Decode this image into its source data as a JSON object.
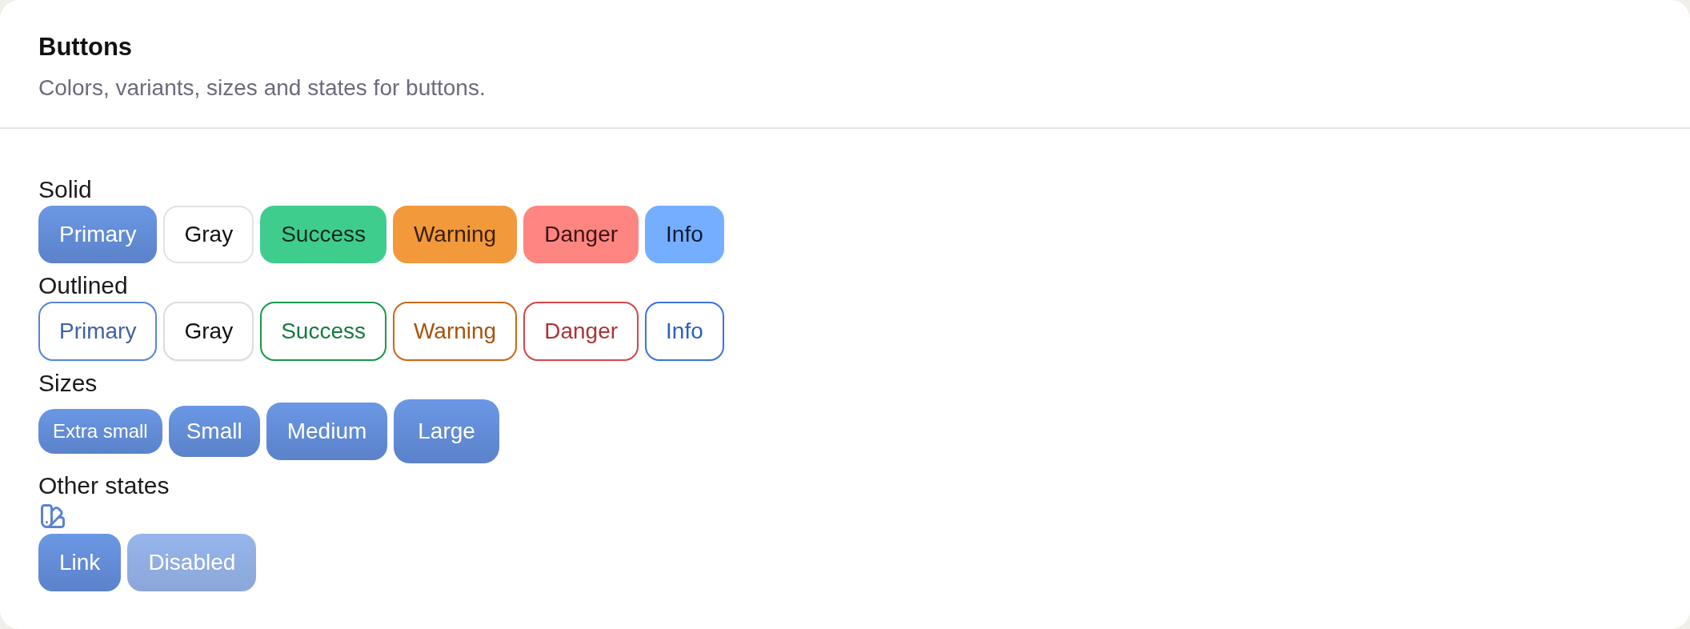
{
  "header": {
    "title": "Buttons",
    "subtitle": "Colors, variants, sizes and states for buttons."
  },
  "sections": [
    {
      "label": "Solid",
      "kind": "solid",
      "buttons": [
        {
          "label": "Primary"
        },
        {
          "label": "Gray"
        },
        {
          "label": "Success"
        },
        {
          "label": "Warning"
        },
        {
          "label": "Danger"
        },
        {
          "label": "Info"
        }
      ]
    },
    {
      "label": "Outlined",
      "kind": "outlined",
      "buttons": [
        {
          "label": "Primary"
        },
        {
          "label": "Gray"
        },
        {
          "label": "Success"
        },
        {
          "label": "Warning"
        },
        {
          "label": "Danger"
        },
        {
          "label": "Info"
        }
      ]
    },
    {
      "label": "Sizes",
      "kind": "sizes",
      "buttons": [
        {
          "label": "Extra small"
        },
        {
          "label": "Small"
        },
        {
          "label": "Medium"
        },
        {
          "label": "Large"
        }
      ]
    },
    {
      "label": "Other states",
      "kind": "states",
      "buttons": [
        {
          "label": "Link",
          "disabled": false
        },
        {
          "label": "Disabled",
          "disabled": true
        }
      ]
    }
  ]
}
